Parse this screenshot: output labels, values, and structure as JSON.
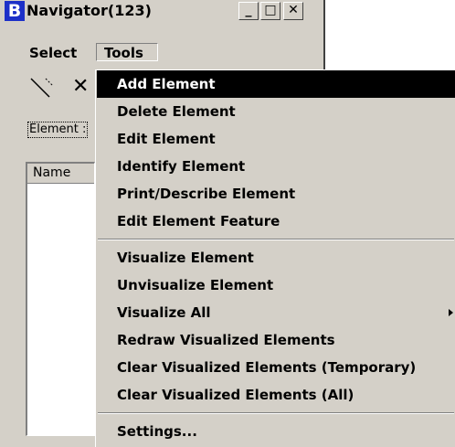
{
  "window": {
    "logo_glyph": "B",
    "title": "Navigator(123)",
    "minimize_glyph": "_",
    "maximize_glyph": "□",
    "close_glyph": "✕"
  },
  "menubar": {
    "select_label": "Select",
    "tools_label": "Tools"
  },
  "toolbar": {
    "icons": [
      "line-tool-icon",
      "delete-x-icon"
    ],
    "delete_glyph": "✕"
  },
  "element_label": "Element :",
  "list": {
    "column_header": "Name"
  },
  "tools_menu": {
    "items": [
      {
        "label": "Add Element",
        "highlighted": true
      },
      {
        "label": "Delete Element"
      },
      {
        "label": "Edit Element"
      },
      {
        "label": "Identify Element"
      },
      {
        "label": "Print/Describe Element"
      },
      {
        "label": "Edit Element Feature"
      },
      {
        "label": "Visualize Element"
      },
      {
        "label": "Unvisualize Element"
      },
      {
        "label": "Visualize All",
        "has_submenu": true
      },
      {
        "label": "Redraw Visualized Elements"
      },
      {
        "label": "Clear Visualized Elements (Temporary)"
      },
      {
        "label": "Clear Visualized Elements (All)"
      },
      {
        "label": "Settings..."
      }
    ]
  },
  "colors": {
    "face": "#d4d0c8",
    "highlight_bg": "#000000",
    "highlight_fg": "#ffffff",
    "logo_bg": "#1c30c8"
  }
}
